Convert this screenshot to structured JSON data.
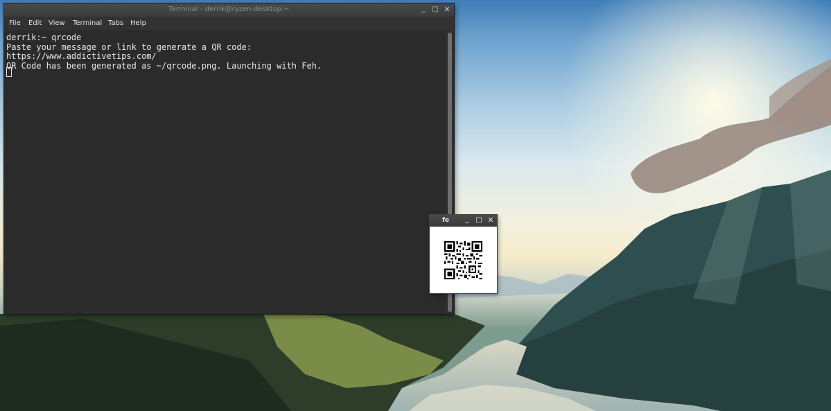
{
  "terminal": {
    "title": "Terminal - derrik@ryzen-desktop:~",
    "window_buttons": {
      "minimize": "_",
      "maximize": "□",
      "close": "✕"
    },
    "menu": [
      "File",
      "Edit",
      "View",
      "Terminal",
      "Tabs",
      "Help"
    ],
    "lines": [
      "derrik:~ qrcode",
      "Paste your message or link to generate a QR code:",
      "https://www.addictivetips.com/",
      "QR Code has been generated as ~/qrcode.png. Launching with Feh."
    ]
  },
  "feh": {
    "title": "fe",
    "window_buttons": {
      "minimize": "_",
      "maximize": "□",
      "close": "✕"
    },
    "image": "qr-code-image"
  },
  "colors": {
    "terminal_bg": "#2b2b2b",
    "titlebar": "#3c3c3c",
    "text": "#e6e6e6"
  }
}
